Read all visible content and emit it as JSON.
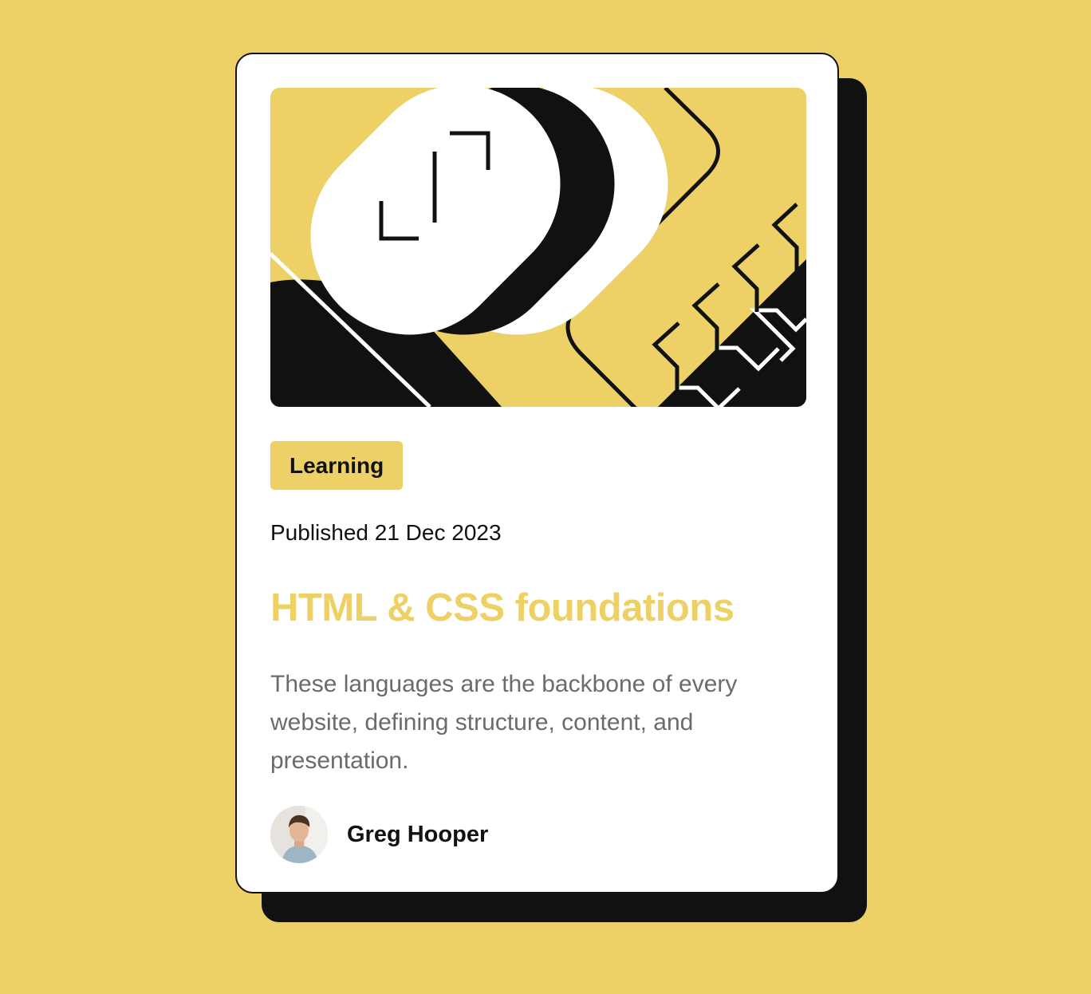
{
  "colors": {
    "background": "#EDD167",
    "card": "#FFFFFF",
    "ink": "#111111",
    "muted_text": "#6B6B6B",
    "accent": "#EDD167"
  },
  "card": {
    "illustration": {
      "icon": "abstract-geometric-illustration"
    },
    "tag": "Learning",
    "published": "Published 21 Dec 2023",
    "title": "HTML & CSS foundations",
    "description": "These languages are the backbone of every website, defining structure, content, and presentation.",
    "author": {
      "name": "Greg Hooper",
      "avatar_icon": "author-avatar-photo"
    }
  }
}
